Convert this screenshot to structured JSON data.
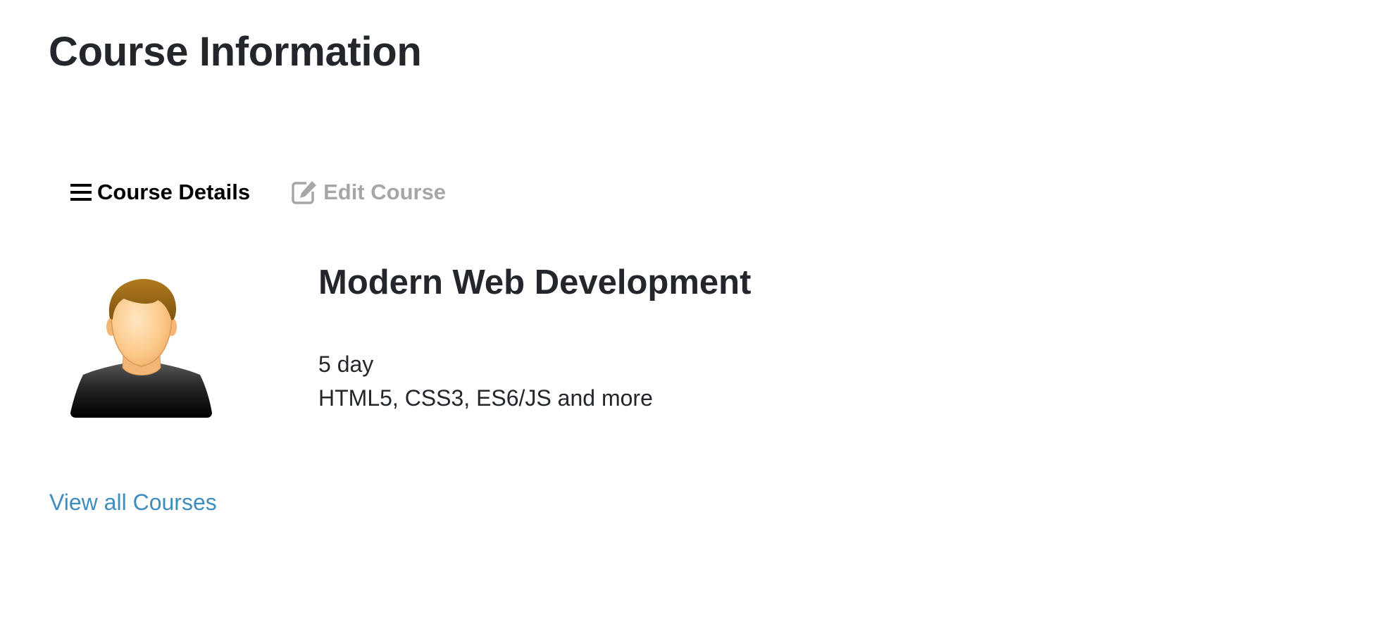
{
  "page": {
    "title": "Course Information"
  },
  "tabs": [
    {
      "label": "Course Details",
      "icon": "list-icon",
      "active": true
    },
    {
      "label": "Edit Course",
      "icon": "edit-icon",
      "active": false
    }
  ],
  "course": {
    "avatar_icon": "user-avatar-icon",
    "name": "Modern Web Development",
    "duration": "5 day",
    "description": "HTML5, CSS3, ES6/JS and more"
  },
  "links": {
    "view_all": "View all Courses"
  },
  "colors": {
    "text": "#23262b",
    "active_tab": "#000000",
    "inactive_tab": "#a6a6a6",
    "link": "#3d8ebf"
  }
}
